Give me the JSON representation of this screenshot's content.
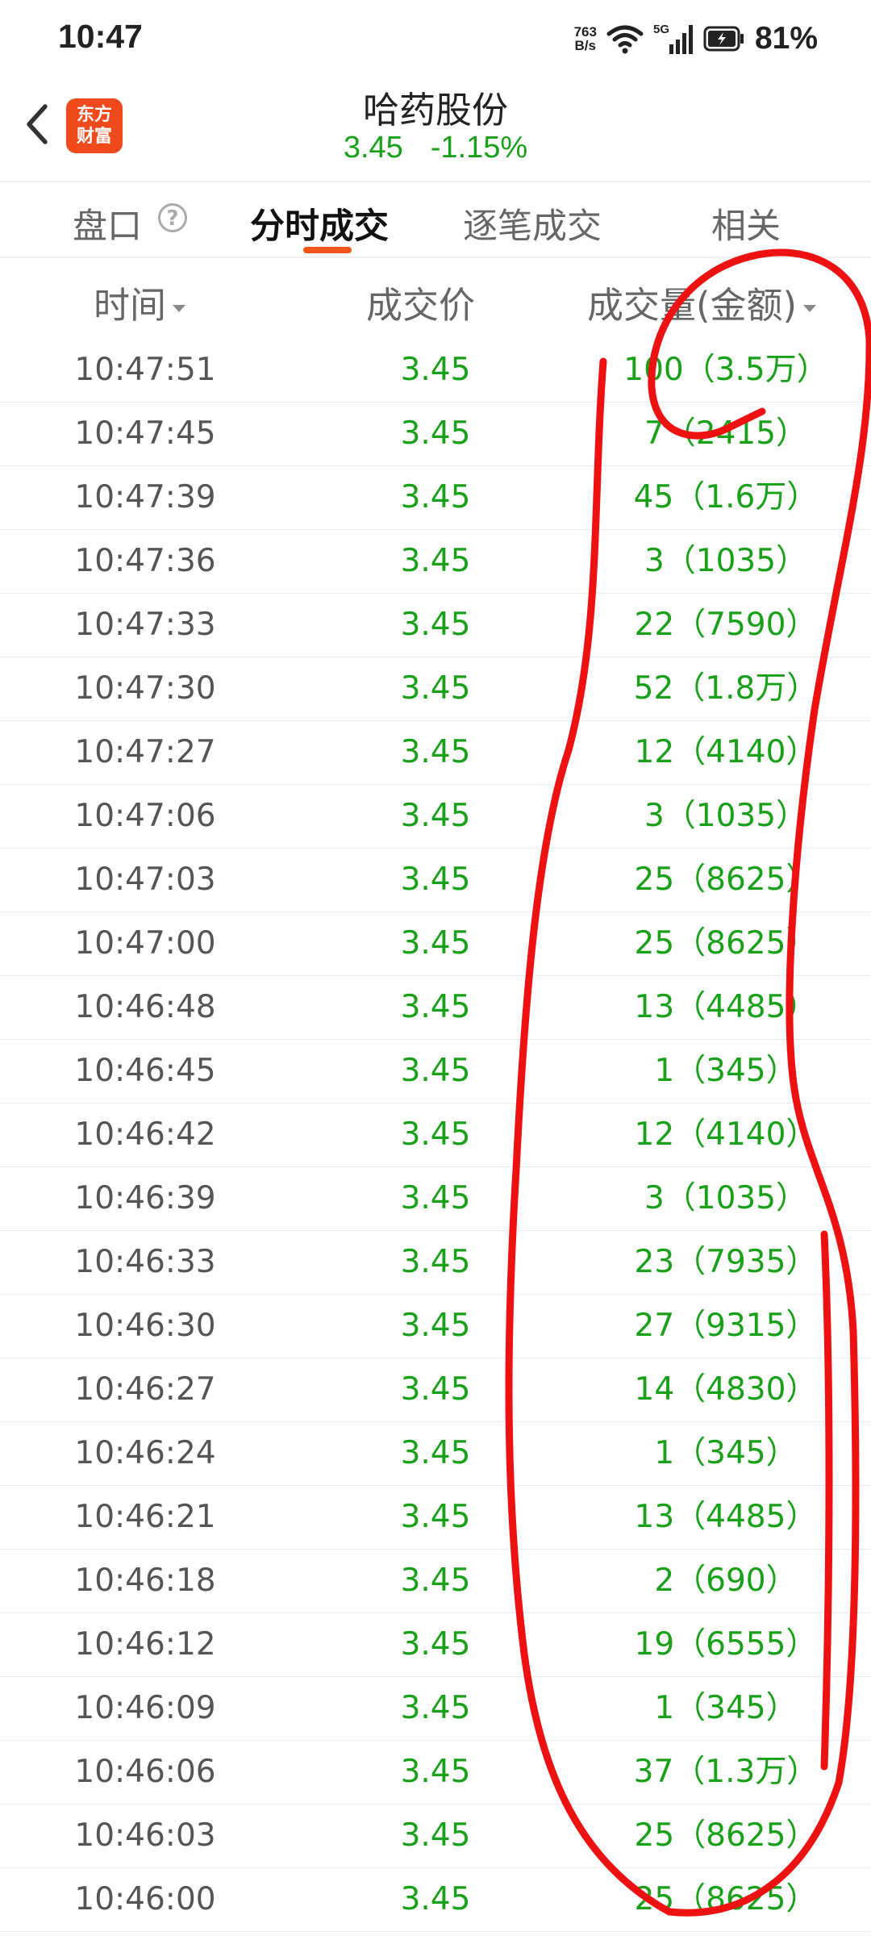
{
  "status_bar": {
    "time": "10:47",
    "net_speed_value": "763",
    "net_speed_unit": "B/s",
    "network": "5G",
    "battery": "81%"
  },
  "header": {
    "logo_line1": "东方",
    "logo_line2": "财富",
    "stock_name": "哈药股份",
    "price": "3.45",
    "change": "-1.15%"
  },
  "tabs": [
    {
      "label": "盘口"
    },
    {
      "label": "分时成交"
    },
    {
      "label": "逐笔成交"
    },
    {
      "label": "相关"
    }
  ],
  "columns": {
    "time": "时间",
    "price": "成交价",
    "volume": "成交量(金额)"
  },
  "colors": {
    "down_green": "#19a019",
    "accent_orange": "#f0551a",
    "annotation_red": "#ee1111"
  },
  "trades": [
    {
      "time": "10:47:51",
      "price": "3.45",
      "volume": "100（3.5万）"
    },
    {
      "time": "10:47:45",
      "price": "3.45",
      "volume": "7（2415）"
    },
    {
      "time": "10:47:39",
      "price": "3.45",
      "volume": "45（1.6万）"
    },
    {
      "time": "10:47:36",
      "price": "3.45",
      "volume": "3（1035）"
    },
    {
      "time": "10:47:33",
      "price": "3.45",
      "volume": "22（7590）"
    },
    {
      "time": "10:47:30",
      "price": "3.45",
      "volume": "52（1.8万）"
    },
    {
      "time": "10:47:27",
      "price": "3.45",
      "volume": "12（4140）"
    },
    {
      "time": "10:47:06",
      "price": "3.45",
      "volume": "3（1035）"
    },
    {
      "time": "10:47:03",
      "price": "3.45",
      "volume": "25（8625）"
    },
    {
      "time": "10:47:00",
      "price": "3.45",
      "volume": "25（8625）"
    },
    {
      "time": "10:46:48",
      "price": "3.45",
      "volume": "13（4485）"
    },
    {
      "time": "10:46:45",
      "price": "3.45",
      "volume": "1（345）"
    },
    {
      "time": "10:46:42",
      "price": "3.45",
      "volume": "12（4140）"
    },
    {
      "time": "10:46:39",
      "price": "3.45",
      "volume": "3（1035）"
    },
    {
      "time": "10:46:33",
      "price": "3.45",
      "volume": "23（7935）"
    },
    {
      "time": "10:46:30",
      "price": "3.45",
      "volume": "27（9315）"
    },
    {
      "time": "10:46:27",
      "price": "3.45",
      "volume": "14（4830）"
    },
    {
      "time": "10:46:24",
      "price": "3.45",
      "volume": "1（345）"
    },
    {
      "time": "10:46:21",
      "price": "3.45",
      "volume": "13（4485）"
    },
    {
      "time": "10:46:18",
      "price": "3.45",
      "volume": "2（690）"
    },
    {
      "time": "10:46:12",
      "price": "3.45",
      "volume": "19（6555）"
    },
    {
      "time": "10:46:09",
      "price": "3.45",
      "volume": "1（345）"
    },
    {
      "time": "10:46:06",
      "price": "3.45",
      "volume": "37（1.3万）"
    },
    {
      "time": "10:46:03",
      "price": "3.45",
      "volume": "25（8625）"
    },
    {
      "time": "10:46:00",
      "price": "3.45",
      "volume": "25（8625）"
    }
  ]
}
